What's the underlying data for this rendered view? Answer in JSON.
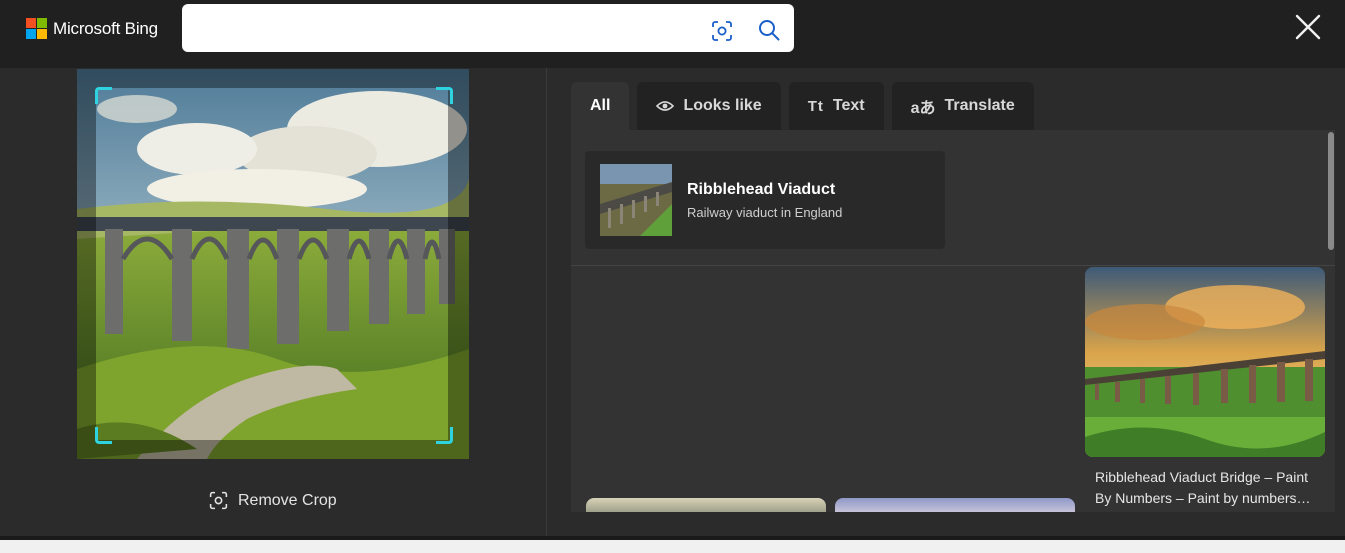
{
  "header": {
    "logo_text": "Microsoft Bing",
    "logo_colors": [
      "#f25022",
      "#7fba00",
      "#00a4ef",
      "#ffb900"
    ],
    "search": {
      "value": "",
      "placeholder": ""
    },
    "icons": {
      "visual_search": "visual-search-icon",
      "search": "search-icon",
      "close": "close-icon"
    }
  },
  "left_pane": {
    "remove_crop_label": "Remove Crop",
    "crop_accent": "#2fd3e0"
  },
  "tabs": [
    {
      "label": "All",
      "icon": "",
      "active": true
    },
    {
      "label": "Looks like",
      "icon": "eye-icon",
      "active": false
    },
    {
      "label": "Text",
      "icon": "text-icon",
      "active": false
    },
    {
      "label": "Translate",
      "icon": "translate-icon",
      "active": false
    }
  ],
  "entity": {
    "title": "Ribblehead Viaduct",
    "subtitle": "Railway viaduct in England"
  },
  "results": [
    {
      "caption": "Ribblehead Viaduct Bridge – Paint By Numbers – Paint by numbers…"
    }
  ]
}
